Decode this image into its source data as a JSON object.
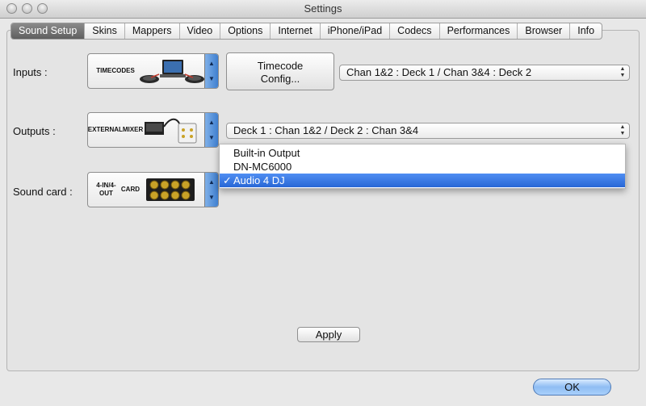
{
  "window": {
    "title": "Settings"
  },
  "tabs": [
    {
      "label": "Sound Setup",
      "active": true
    },
    {
      "label": "Skins"
    },
    {
      "label": "Mappers"
    },
    {
      "label": "Video"
    },
    {
      "label": "Options"
    },
    {
      "label": "Internet"
    },
    {
      "label": "iPhone/iPad"
    },
    {
      "label": "Codecs"
    },
    {
      "label": "Performances"
    },
    {
      "label": "Browser"
    },
    {
      "label": "Info"
    }
  ],
  "inputs": {
    "label": "Inputs :",
    "image_caption": "TIMECODES",
    "config_button_line1": "Timecode",
    "config_button_line2": "Config...",
    "routing_value": "Chan 1&2 : Deck 1 / Chan 3&4 : Deck 2"
  },
  "outputs": {
    "label": "Outputs :",
    "image_caption_line1": "EXTERNAL",
    "image_caption_line2": "MIXER",
    "routing_value": "Deck 1 : Chan 1&2 / Deck 2 : Chan 3&4"
  },
  "soundcard": {
    "label": "Sound card :",
    "image_caption_line1": "4-IN/4-OUT",
    "image_caption_line2": "CARD",
    "menu_items": [
      "Built-in Output",
      "DN-MC6000",
      "Audio 4 DJ"
    ],
    "selected_index": 2,
    "check_glyph": "✓"
  },
  "buttons": {
    "apply": "Apply",
    "ok": "OK"
  },
  "colors": {
    "selection": "#2867d6",
    "active_tab": "#6b6b6b",
    "stepper": "#4a88d6"
  }
}
